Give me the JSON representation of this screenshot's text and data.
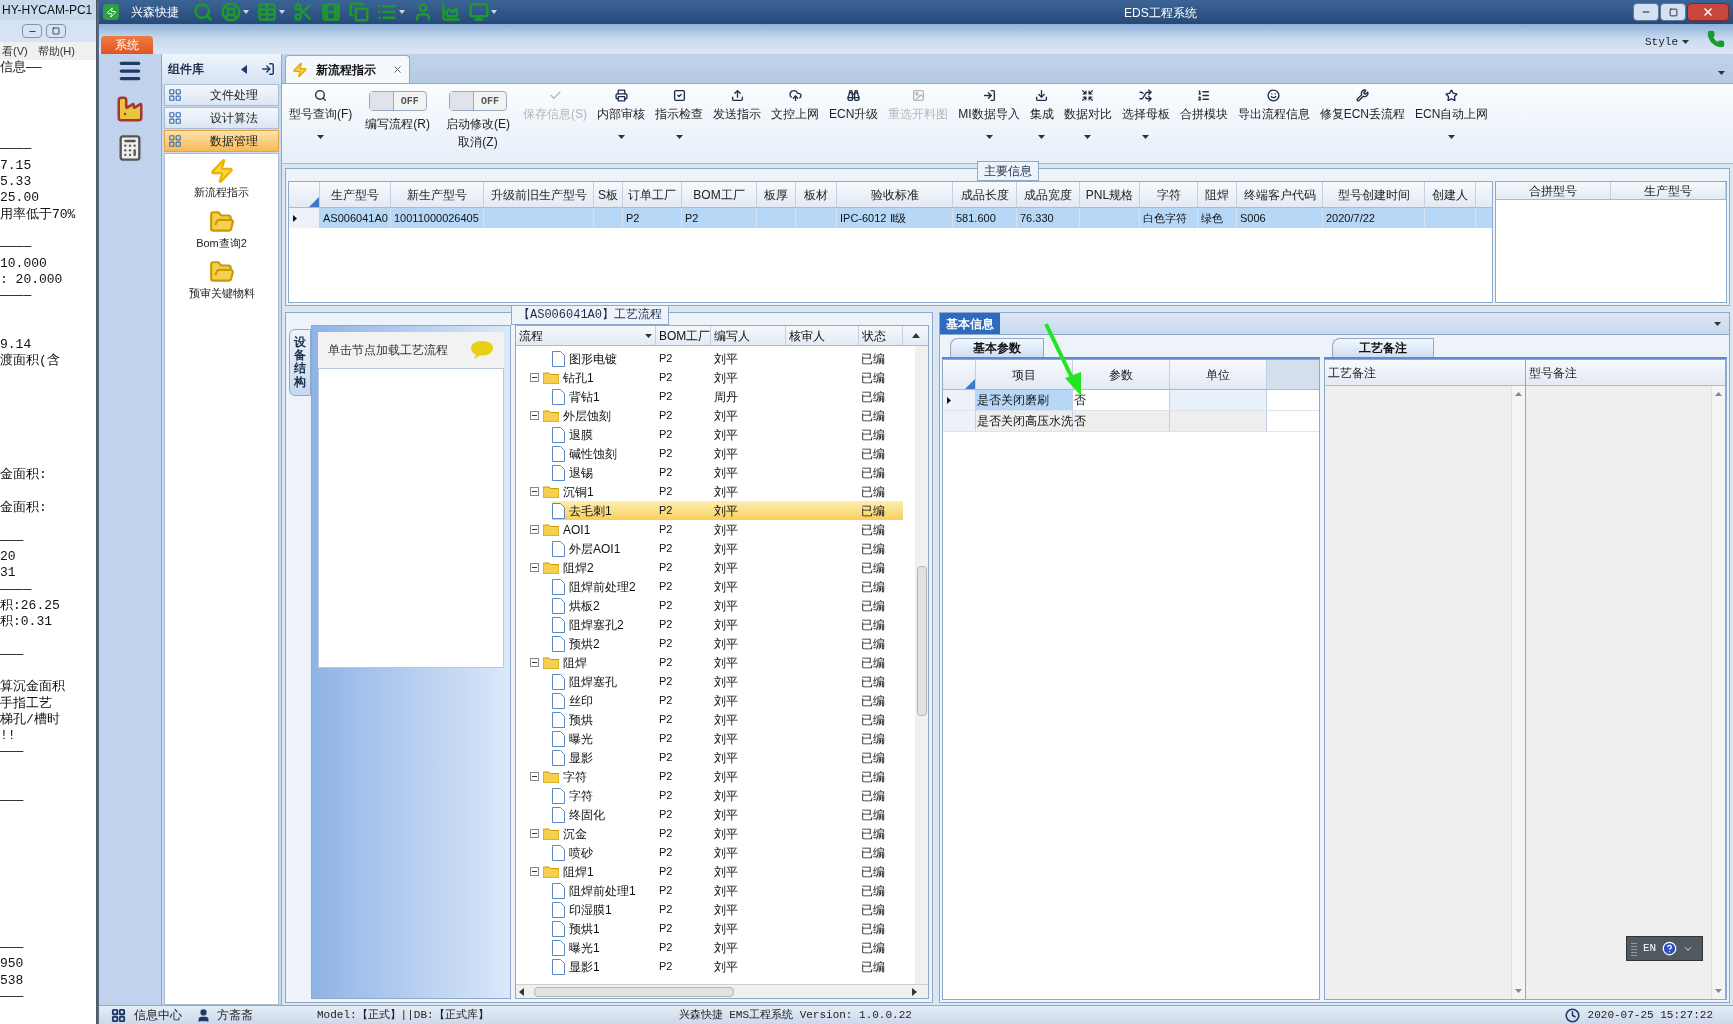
{
  "background_window": {
    "title": "HY-HYCAM-PC1",
    "menu": [
      "看(V)",
      "帮助(H)"
    ],
    "lines": [
      {
        "text": "信息——"
      },
      {
        "text": "————"
      },
      {
        "text": "7.15"
      },
      {
        "text": "5.33"
      },
      {
        "text": "25.00"
      },
      {
        "text": "用率低于70%"
      },
      {
        "text": "————"
      },
      {
        "text": "10.000"
      },
      {
        "text": ":  20.000"
      },
      {
        "text": "————"
      },
      {
        "text": "9.14"
      },
      {
        "text": "渡面积(含"
      },
      {
        "text": "金面积:"
      },
      {
        "text": "金面积:"
      },
      {
        "text": "———"
      },
      {
        "text": " 20"
      },
      {
        "text": " 31"
      },
      {
        "text": "————"
      },
      {
        "text": "积:26.25"
      },
      {
        "text": "积:0.31"
      },
      {
        "text": "———"
      },
      {
        "text": "算沉金面积"
      },
      {
        "text": "手指工艺"
      },
      {
        "text": "梯孔/槽时"
      },
      {
        "text": "!!"
      },
      {
        "text": "———"
      },
      {
        "text": "———"
      },
      {
        "text": "———"
      },
      {
        "text": "950"
      },
      {
        "text": "538"
      },
      {
        "text": "———"
      }
    ]
  },
  "window": {
    "title": "EDS工程系统",
    "quick_access_label": "兴森快捷",
    "system_tab": "系统",
    "style_label": "Style"
  },
  "component_library": {
    "title": "组件库",
    "items": [
      {
        "label": "文件处理",
        "selected": false
      },
      {
        "label": "设计算法",
        "selected": false
      },
      {
        "label": "数据管理",
        "selected": true
      }
    ],
    "shortcuts": [
      "新流程指示",
      "Bom查询2",
      "预审关键物料"
    ]
  },
  "tabs": [
    {
      "label": "新流程指示",
      "selected": true
    }
  ],
  "toolbar": [
    {
      "kind": "button",
      "label": "型号查询(F)",
      "dropdown": true,
      "disabled": false
    },
    {
      "kind": "toggle",
      "label": "编写流程(R)",
      "on": false,
      "state_text": "OFF"
    },
    {
      "kind": "toggle",
      "label": "启动修改(E)",
      "label_2": "取消(Z)",
      "on": false,
      "state_text": "OFF"
    },
    {
      "kind": "button",
      "label": "保存信息(S)",
      "dropdown": false,
      "disabled": true
    },
    {
      "kind": "button",
      "label": "内部审核",
      "dropdown": true,
      "disabled": false
    },
    {
      "kind": "button",
      "label": "指示检查",
      "dropdown": true,
      "disabled": false
    },
    {
      "kind": "button",
      "label": "发送指示",
      "dropdown": false,
      "disabled": false
    },
    {
      "kind": "button",
      "label": "文控上网",
      "dropdown": false,
      "disabled": false
    },
    {
      "kind": "button",
      "label": "ECN升级",
      "dropdown": false,
      "disabled": false
    },
    {
      "kind": "button",
      "label": "重选开料图",
      "dropdown": false,
      "disabled": true
    },
    {
      "kind": "button",
      "label": "MI数据导入",
      "dropdown": true,
      "disabled": false
    },
    {
      "kind": "button",
      "label": "集成",
      "dropdown": true,
      "disabled": false
    },
    {
      "kind": "button",
      "label": "数据对比",
      "dropdown": true,
      "disabled": false
    },
    {
      "kind": "button",
      "label": "选择母板",
      "dropdown": true,
      "disabled": false
    },
    {
      "kind": "button",
      "label": "合拼模块",
      "dropdown": false,
      "disabled": false
    },
    {
      "kind": "button",
      "label": "导出流程信息",
      "dropdown": false,
      "disabled": false
    },
    {
      "kind": "button",
      "label": "修复ECN丢流程",
      "dropdown": false,
      "disabled": false
    },
    {
      "kind": "button",
      "label": "ECN自动上网",
      "dropdown": true,
      "disabled": false
    }
  ],
  "main_info": {
    "title": "主要信息",
    "columns": [
      "生产型号",
      "新生产型号",
      "升级前旧生产型号",
      "S板",
      "订单工厂",
      "BOM工厂",
      "板厚",
      "板材",
      "验收标准",
      "成品长度",
      "成品宽度",
      "PNL规格",
      "字符",
      "阻焊",
      "终端客户代码",
      "型号创建时间",
      "创建人"
    ],
    "rows": [
      {
        "selected": true,
        "cells": [
          "AS006041A0",
          "10011000026405",
          null,
          null,
          "P2",
          "P2",
          null,
          null,
          "IPC-6012 Ⅱ级",
          "581.600",
          "76.330",
          null,
          "白色字符",
          "绿色",
          "S006",
          "2020/7/22",
          null
        ]
      }
    ],
    "side_columns": [
      "合拼型号",
      "生产型号"
    ]
  },
  "device_panel": {
    "tab": "设备结构",
    "hint": "单击节点加载工艺流程"
  },
  "process_tree": {
    "title": "【AS006041A0】工艺流程",
    "columns": [
      "流程",
      "BOM工厂",
      "编写人",
      "核审人",
      "状态"
    ],
    "items": [
      {
        "children": [
          {
            "name": "图形电镀",
            "bom": "P2",
            "writer": "刘平",
            "status": "已编",
            "selected": false
          }
        ]
      },
      {
        "name": "钻孔1",
        "bom": "P2",
        "writer": "刘平",
        "status": "已编",
        "expanded": true,
        "selected": false,
        "children": [
          {
            "name": "背钻1",
            "bom": "P2",
            "writer": "周丹",
            "status": "已编",
            "selected": false
          }
        ]
      },
      {
        "name": "外层蚀刻",
        "bom": "P2",
        "writer": "刘平",
        "status": "已编",
        "expanded": true,
        "selected": false,
        "children": [
          {
            "name": "退膜",
            "bom": "P2",
            "writer": "刘平",
            "status": "已编",
            "selected": false
          },
          {
            "name": "碱性蚀刻",
            "bom": "P2",
            "writer": "刘平",
            "status": "已编",
            "selected": false
          },
          {
            "name": "退锡",
            "bom": "P2",
            "writer": "刘平",
            "status": "已编",
            "selected": false
          }
        ]
      },
      {
        "name": "沉铜1",
        "bom": "P2",
        "writer": "刘平",
        "status": "已编",
        "expanded": true,
        "selected": false,
        "children": [
          {
            "name": "去毛刺1",
            "bom": "P2",
            "writer": "刘平",
            "status": "已编",
            "selected": true
          }
        ]
      },
      {
        "name": "AOI1",
        "bom": "P2",
        "writer": "刘平",
        "status": "已编",
        "expanded": true,
        "selected": false,
        "children": [
          {
            "name": "外层AOI1",
            "bom": "P2",
            "writer": "刘平",
            "status": "已编",
            "selected": false
          }
        ]
      },
      {
        "name": "阻焊2",
        "bom": "P2",
        "writer": "刘平",
        "status": "已编",
        "expanded": true,
        "selected": false,
        "children": [
          {
            "name": "阻焊前处理2",
            "bom": "P2",
            "writer": "刘平",
            "status": "已编",
            "selected": false
          },
          {
            "name": "烘板2",
            "bom": "P2",
            "writer": "刘平",
            "status": "已编",
            "selected": false
          },
          {
            "name": "阻焊塞孔2",
            "bom": "P2",
            "writer": "刘平",
            "status": "已编",
            "selected": false
          },
          {
            "name": "预烘2",
            "bom": "P2",
            "writer": "刘平",
            "status": "已编",
            "selected": false
          }
        ]
      },
      {
        "name": "阻焊",
        "bom": "P2",
        "writer": "刘平",
        "status": "已编",
        "expanded": true,
        "selected": false,
        "children": [
          {
            "name": "阻焊塞孔",
            "bom": "P2",
            "writer": "刘平",
            "status": "已编",
            "selected": false
          },
          {
            "name": "丝印",
            "bom": "P2",
            "writer": "刘平",
            "status": "已编",
            "selected": false
          },
          {
            "name": "预烘",
            "bom": "P2",
            "writer": "刘平",
            "status": "已编",
            "selected": false
          },
          {
            "name": "曝光",
            "bom": "P2",
            "writer": "刘平",
            "status": "已编",
            "selected": false
          },
          {
            "name": "显影",
            "bom": "P2",
            "writer": "刘平",
            "status": "已编",
            "selected": false
          }
        ]
      },
      {
        "name": "字符",
        "bom": "P2",
        "writer": "刘平",
        "status": "已编",
        "expanded": true,
        "selected": false,
        "children": [
          {
            "name": "字符",
            "bom": "P2",
            "writer": "刘平",
            "status": "已编",
            "selected": false
          },
          {
            "name": "终固化",
            "bom": "P2",
            "writer": "刘平",
            "status": "已编",
            "selected": false
          }
        ]
      },
      {
        "name": "沉金",
        "bom": "P2",
        "writer": "刘平",
        "status": "已编",
        "expanded": true,
        "selected": false,
        "children": [
          {
            "name": "喷砂",
            "bom": "P2",
            "writer": "刘平",
            "status": "已编",
            "selected": false
          }
        ]
      },
      {
        "name": "阻焊1",
        "bom": "P2",
        "writer": "刘平",
        "status": "已编",
        "expanded": true,
        "selected": false,
        "children": [
          {
            "name": "阻焊前处理1",
            "bom": "P2",
            "writer": "刘平",
            "status": "已编",
            "selected": false
          },
          {
            "name": "印湿膜1",
            "bom": "P2",
            "writer": "刘平",
            "status": "已编",
            "selected": false
          },
          {
            "name": "预烘1",
            "bom": "P2",
            "writer": "刘平",
            "status": "已编",
            "selected": false
          },
          {
            "name": "曝光1",
            "bom": "P2",
            "writer": "刘平",
            "status": "已编",
            "selected": false
          },
          {
            "name": "显影1",
            "bom": "P2",
            "writer": "刘平",
            "status": "已编",
            "selected": false
          }
        ]
      }
    ]
  },
  "basic_info": {
    "title": "基本信息",
    "params_tab": "基本参数",
    "params_columns": [
      "项目",
      "参数",
      "单位"
    ],
    "params_rows": [
      {
        "item": "是否关闭磨刷",
        "value": "否",
        "selected": true
      },
      {
        "item": "是否关闭高压水洗",
        "value": "否",
        "selected": false
      }
    ],
    "notes_tab": "工艺备注",
    "notes_columns": [
      "工艺备注",
      "型号备注"
    ]
  },
  "language_bar": {
    "label": "EN"
  },
  "status_bar": {
    "info_center": "信息中心",
    "user": "方斋斋",
    "model_db": "Model:【正式】||DB:【正式库】",
    "version": "兴森快捷 EMS工程系统 Version: 1.0.0.22",
    "datetime": "2020-07-25 15:27:22"
  }
}
